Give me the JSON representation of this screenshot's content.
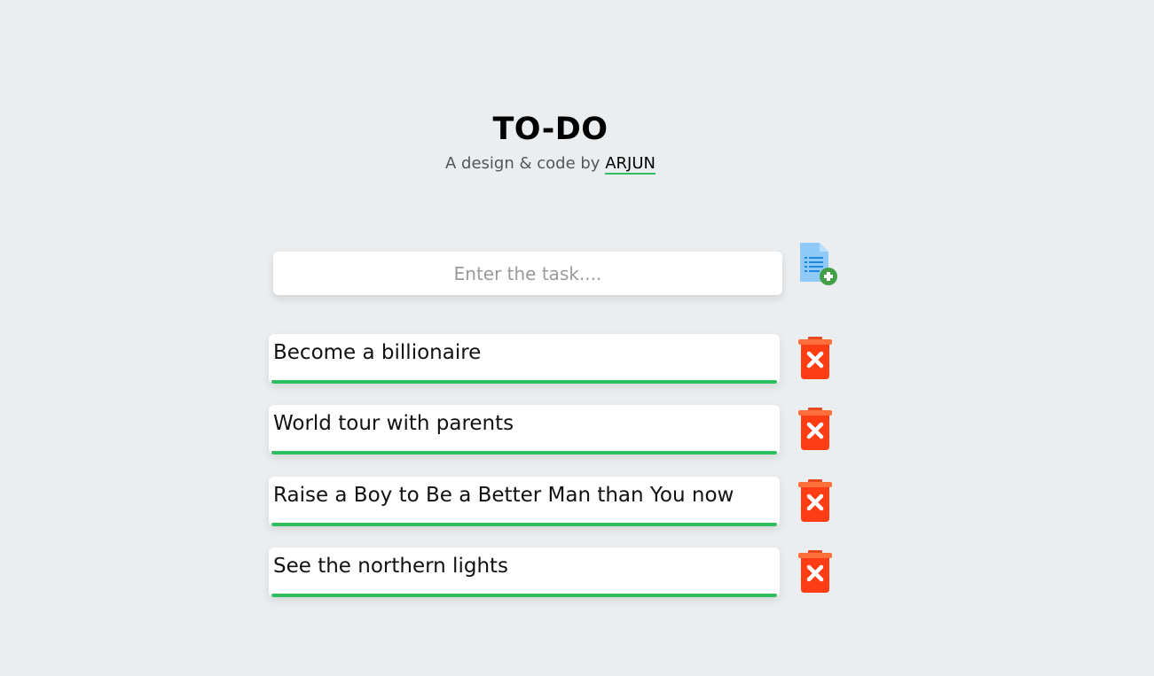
{
  "header": {
    "title": "TO-DO",
    "subtitle_prefix": "A design & code by ",
    "author": "ARJUN"
  },
  "input": {
    "placeholder": "Enter the task....",
    "value": ""
  },
  "icons": {
    "add": "add-task-icon",
    "delete": "trash-delete-icon"
  },
  "colors": {
    "background": "#ebeef0",
    "accent_green": "#2dbe60",
    "delete_red": "#ff3d14"
  },
  "tasks": [
    {
      "text": "Become a billionaire"
    },
    {
      "text": "World tour with parents"
    },
    {
      "text": "Raise a Boy to Be a Better Man than You now"
    },
    {
      "text": "See the northern lights"
    }
  ]
}
